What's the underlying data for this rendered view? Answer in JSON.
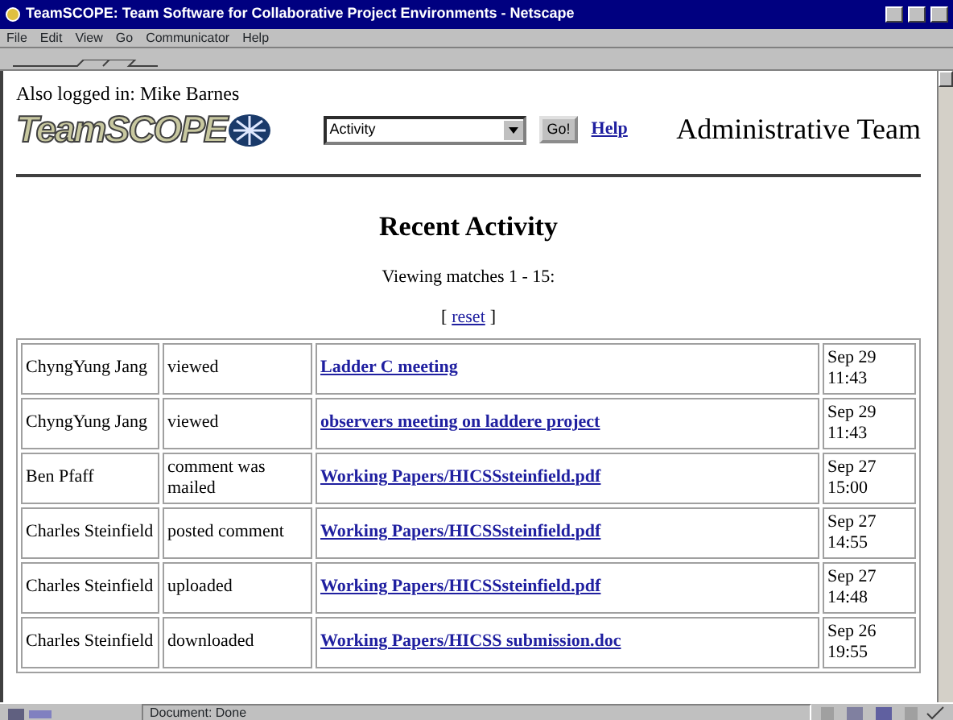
{
  "window": {
    "title": "TeamSCOPE: Team Software for Collaborative Project Environments - Netscape"
  },
  "menu": [
    "File",
    "Edit",
    "View",
    "Go",
    "Communicator",
    "Help"
  ],
  "header": {
    "logged_in": "Also logged in: Mike Barnes",
    "logo": "TeamSCOPE",
    "select": "Activity",
    "go": "Go!",
    "help": "Help",
    "team": "Administrative Team"
  },
  "heading": "Recent Activity",
  "matches": "Viewing matches 1 - 15:",
  "reset": {
    "open": "[",
    "link": "reset",
    "close": "]"
  },
  "rows": [
    {
      "user": "ChyngYung Jang",
      "action": "viewed",
      "item": "Ladder C meeting",
      "date": "Sep 29 11:43"
    },
    {
      "user": "ChyngYung Jang",
      "action": "viewed",
      "item": "observers meeting on laddere project",
      "date": "Sep 29 11:43"
    },
    {
      "user": "Ben Pfaff",
      "action": "comment was mailed",
      "item": "Working Papers/HICSSsteinfield.pdf",
      "date": "Sep 27 15:00"
    },
    {
      "user": "Charles Steinfield",
      "action": "posted comment",
      "item": "Working Papers/HICSSsteinfield.pdf",
      "date": "Sep 27 14:55"
    },
    {
      "user": "Charles Steinfield",
      "action": "uploaded",
      "item": "Working Papers/HICSSsteinfield.pdf",
      "date": "Sep 27 14:48"
    },
    {
      "user": "Charles Steinfield",
      "action": "downloaded",
      "item": "Working Papers/HICSS submission.doc",
      "date": "Sep 26 19:55"
    }
  ],
  "status_bar": {
    "text": "Document: Done"
  }
}
